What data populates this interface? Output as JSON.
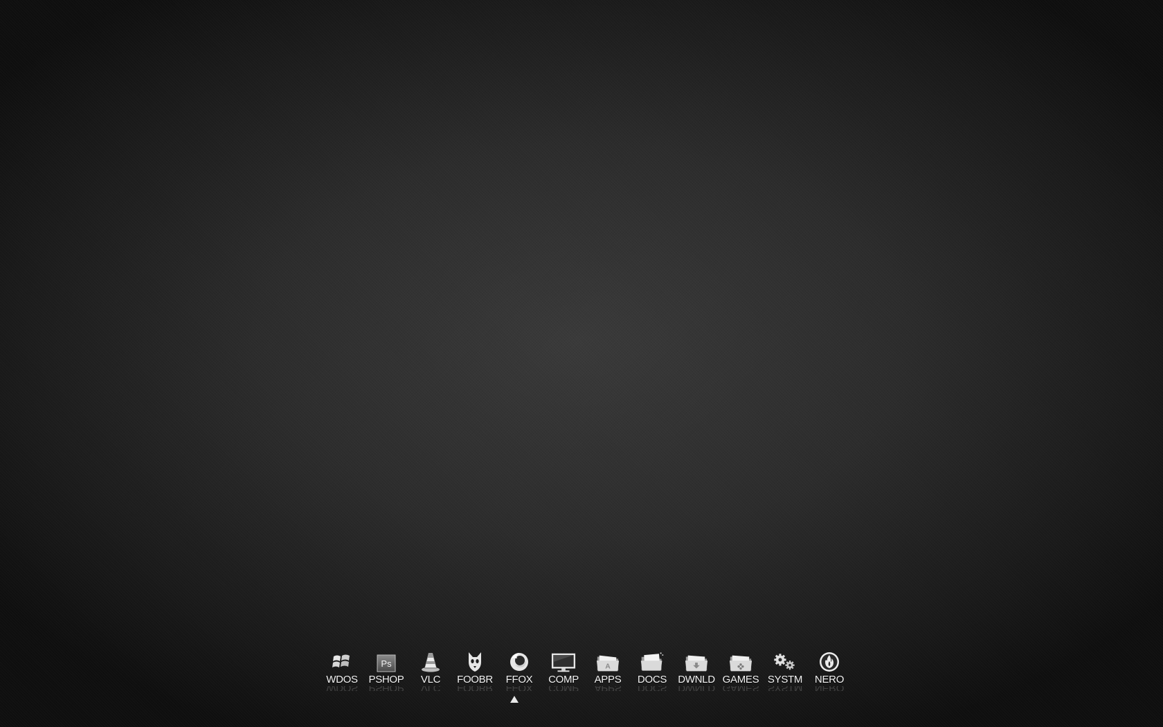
{
  "dock": {
    "items": [
      {
        "label": "WDOS",
        "icon": "windows-icon"
      },
      {
        "label": "PSHOP",
        "icon": "photoshop-icon"
      },
      {
        "label": "VLC",
        "icon": "vlc-cone-icon"
      },
      {
        "label": "FOOBR",
        "icon": "foobar-icon"
      },
      {
        "label": "FFOX",
        "icon": "firefox-icon"
      },
      {
        "label": "COMP",
        "icon": "monitor-icon"
      },
      {
        "label": "APPS",
        "icon": "apps-folder-icon"
      },
      {
        "label": "DOCS",
        "icon": "docs-folder-icon"
      },
      {
        "label": "DWNLD",
        "icon": "download-folder-icon"
      },
      {
        "label": "GAMES",
        "icon": "games-folder-icon"
      },
      {
        "label": "SYSTM",
        "icon": "gears-icon"
      },
      {
        "label": "NERO",
        "icon": "nero-flame-icon"
      }
    ],
    "active_item": "FFOX",
    "photoshop_badge": "Ps"
  },
  "colors": {
    "background_center": "#3a3a3a",
    "background_edge": "#0f0f0f",
    "label": "#f2f2f2",
    "icon": "#e6e6e6"
  }
}
